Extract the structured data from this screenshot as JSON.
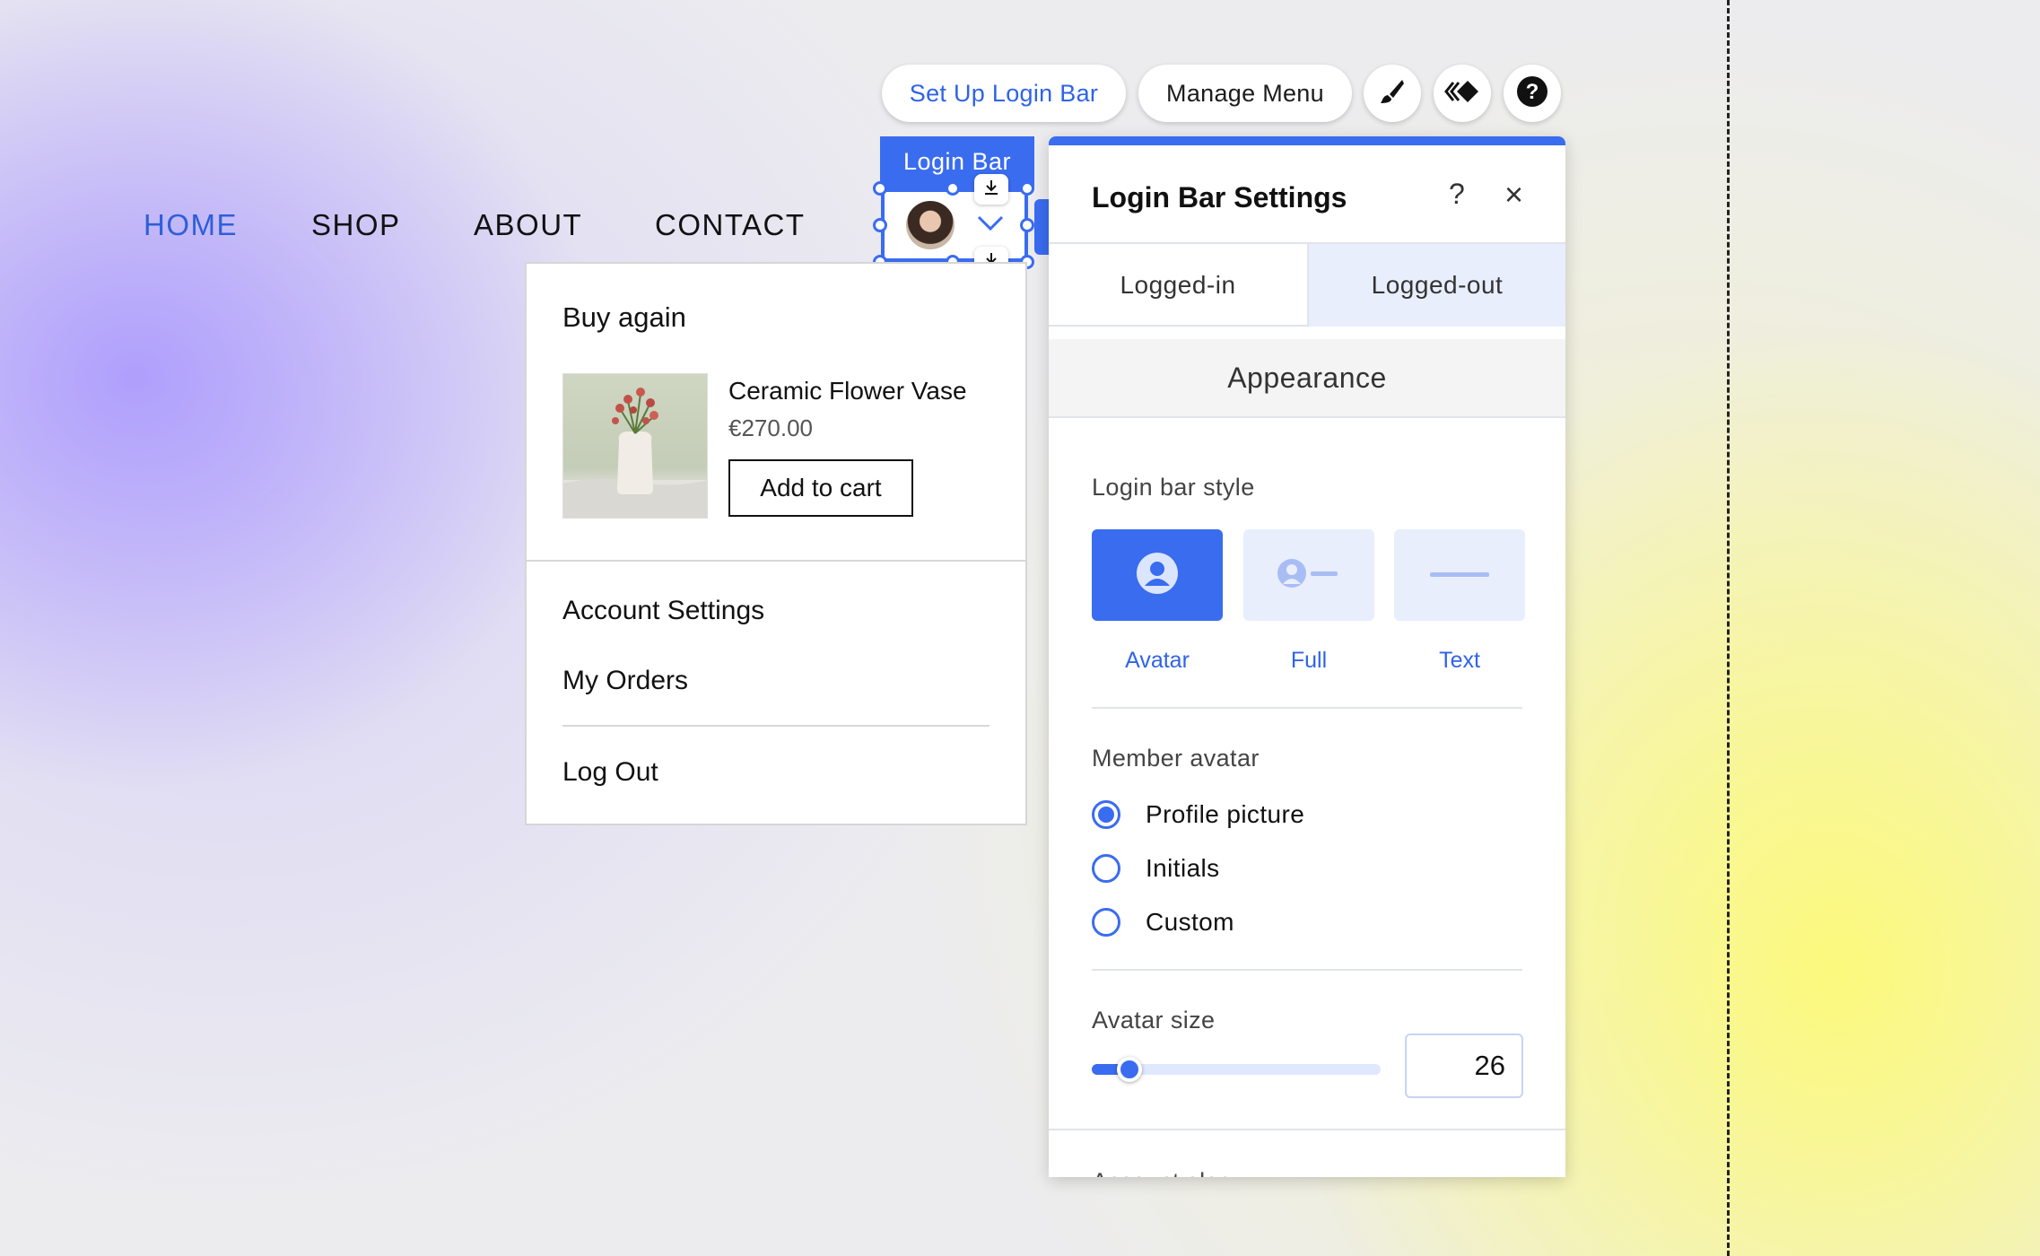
{
  "toolbar": {
    "setup_label": "Set Up Login Bar",
    "manage_menu_label": "Manage Menu",
    "icons": [
      "brush-icon",
      "animation-icon",
      "help-icon"
    ]
  },
  "nav": {
    "items": [
      {
        "label": "HOME",
        "active": true
      },
      {
        "label": "SHOP",
        "active": false
      },
      {
        "label": "ABOUT",
        "active": false
      },
      {
        "label": "CONTACT",
        "active": false
      }
    ]
  },
  "login_bar": {
    "tag_label": "Login Bar",
    "accent": "#3a6cf0"
  },
  "dropdown": {
    "title": "Buy again",
    "product": {
      "name": "Ceramic Flower Vase",
      "price": "€270.00",
      "add_to_cart": "Add to cart"
    },
    "links": [
      "Account Settings",
      "My Orders",
      "Log Out"
    ]
  },
  "settings_panel": {
    "title": "Login Bar Settings",
    "help": "?",
    "close": "×",
    "tabs": [
      {
        "label": "Logged-in",
        "selected": true
      },
      {
        "label": "Logged-out",
        "selected": false
      }
    ],
    "section": "Appearance",
    "login_bar_style": {
      "label": "Login bar style",
      "options": [
        {
          "label": "Avatar",
          "selected": true
        },
        {
          "label": "Full",
          "selected": false
        },
        {
          "label": "Text",
          "selected": false
        }
      ]
    },
    "member_avatar": {
      "label": "Member avatar",
      "options": [
        {
          "label": "Profile picture",
          "selected": true
        },
        {
          "label": "Initials",
          "selected": false
        },
        {
          "label": "Custom",
          "selected": false
        }
      ]
    },
    "avatar_size": {
      "label": "Avatar size",
      "value": "26",
      "slider_fraction": 0.13
    },
    "next_section_partial": "Account alar"
  }
}
